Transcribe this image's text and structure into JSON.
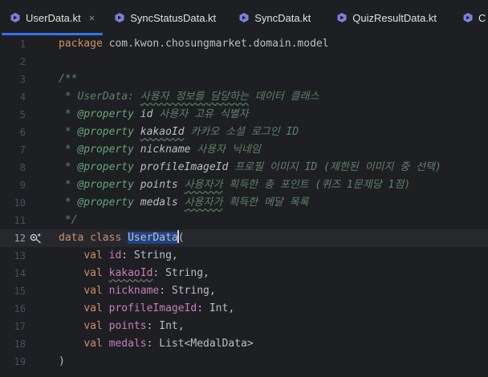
{
  "tabs": [
    {
      "label": "UserData.kt",
      "active": true,
      "close": "×"
    },
    {
      "label": "SyncStatusData.kt"
    },
    {
      "label": "SyncData.kt"
    },
    {
      "label": "QuizResultData.kt"
    },
    {
      "label": "C"
    }
  ],
  "lines": [
    {
      "num": "1",
      "package_kw": "package",
      "package_name": " com.kwon.chosungmarket.domain.model"
    },
    {
      "num": "2"
    },
    {
      "num": "3",
      "text": "/**"
    },
    {
      "num": "4",
      "prefix": " * UserData: ",
      "desc_wavy": "사용자 정보를 담당하는",
      "suffix": " 데이터 클래스"
    },
    {
      "num": "5",
      "prefix": " * ",
      "tag": "@property",
      "param": " id",
      "desc": " 사용자 고유 식별자"
    },
    {
      "num": "6",
      "prefix": " * ",
      "tag": "@property",
      "param": "kakaoId",
      "desc": " 카카오 소셜 로그인 ID"
    },
    {
      "num": "7",
      "prefix": " * ",
      "tag": "@property",
      "param": " nickname",
      "desc": " 사용자 닉네임"
    },
    {
      "num": "8",
      "prefix": " * ",
      "tag": "@property",
      "param": " profileImageId",
      "desc": " 프로필 이미지 ID (제한된 이미지 중 선택)"
    },
    {
      "num": "9",
      "prefix": " * ",
      "tag": "@property",
      "param": " points",
      "desc_wavy": "사용자가",
      "desc": " 획득한 총 포인트 (퀴즈 1문제당 1점)"
    },
    {
      "num": "10",
      "prefix": " * ",
      "tag": "@property",
      "param": " medals",
      "desc_wavy": "사용자가",
      "desc": " 획득한 메달 목록"
    },
    {
      "num": "11",
      "text": " */"
    },
    {
      "num": "12",
      "kw": "data class",
      "cls": "UserData",
      "rest": "("
    },
    {
      "num": "13",
      "kw": "val",
      "prop": "id",
      "rest": ": String,"
    },
    {
      "num": "14",
      "kw": "val",
      "prop": "kakaoId",
      "rest": ": String,"
    },
    {
      "num": "15",
      "kw": "val",
      "prop": "nickname",
      "rest": ": String,"
    },
    {
      "num": "16",
      "kw": "val",
      "prop": "profileImageId",
      "rest": ": Int,"
    },
    {
      "num": "17",
      "kw": "val",
      "prop": "points",
      "rest": ": Int,"
    },
    {
      "num": "18",
      "kw": "val",
      "prop": "medals",
      "rest": ": List<MedalData>"
    },
    {
      "num": "19",
      "text": ")"
    }
  ],
  "colors": {
    "keyword": "#cf8e6d",
    "doc_comment": "#5f826b",
    "property": "#c77dbb",
    "accent": "#3574f0",
    "kotlin_icon": "#7f7fdc"
  },
  "icons": {
    "tab": "kotlin-file-icon",
    "gutter": "implementations-gutter-icon"
  }
}
